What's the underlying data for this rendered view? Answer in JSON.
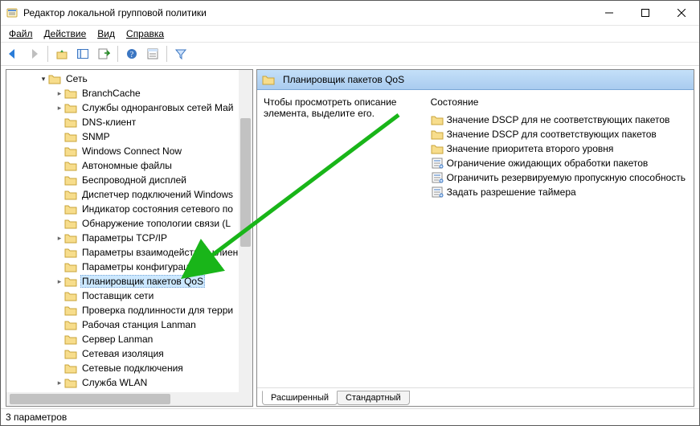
{
  "window": {
    "title": "Редактор локальной групповой политики"
  },
  "menus": {
    "file": "Файл",
    "action": "Действие",
    "view": "Вид",
    "help": "Справка"
  },
  "tree_parent": {
    "label": "Сеть"
  },
  "tree_items": [
    {
      "label": "BranchCache",
      "expander": ">"
    },
    {
      "label": "Службы одноранговых сетей Май",
      "expander": ">"
    },
    {
      "label": "DNS-клиент",
      "expander": ""
    },
    {
      "label": "SNMP",
      "expander": ""
    },
    {
      "label": "Windows Connect Now",
      "expander": ""
    },
    {
      "label": "Автономные файлы",
      "expander": ""
    },
    {
      "label": "Беспроводной дисплей",
      "expander": ""
    },
    {
      "label": "Диспетчер подключений Windows",
      "expander": ""
    },
    {
      "label": "Индикатор состояния сетевого по",
      "expander": ""
    },
    {
      "label": "Обнаружение топологии связи (L",
      "expander": ""
    },
    {
      "label": "Параметры TCP/IP",
      "expander": ">"
    },
    {
      "label": "Параметры взаимодействия клиен",
      "expander": ""
    },
    {
      "label": "Параметры конфигурации SSL",
      "expander": ""
    },
    {
      "label": "Планировщик пакетов QoS",
      "expander": ">",
      "selected": true
    },
    {
      "label": "Поставщик сети",
      "expander": ""
    },
    {
      "label": "Проверка подлинности для терри",
      "expander": ""
    },
    {
      "label": "Рабочая станция Lanman",
      "expander": ""
    },
    {
      "label": "Сервер Lanman",
      "expander": ""
    },
    {
      "label": "Сетевая изоляция",
      "expander": ""
    },
    {
      "label": "Сетевые подключения",
      "expander": ""
    },
    {
      "label": "Служба WLAN",
      "expander": ">"
    }
  ],
  "right": {
    "header_title": "Планировщик пакетов QoS",
    "description": "Чтобы просмотреть описание элемента, выделите его.",
    "state_heading": "Состояние",
    "items": [
      {
        "kind": "folder",
        "label": "Значение DSCP для не соответствующих пакетов"
      },
      {
        "kind": "folder",
        "label": "Значение DSCP для соответствующих пакетов"
      },
      {
        "kind": "folder",
        "label": "Значение приоритета второго уровня"
      },
      {
        "kind": "setting",
        "label": "Ограничение ожидающих обработки пакетов"
      },
      {
        "kind": "setting",
        "label": "Ограничить резервируемую пропускную способность"
      },
      {
        "kind": "setting",
        "label": "Задать разрешение таймера"
      }
    ],
    "tabs": {
      "extended": "Расширенный",
      "standard": "Стандартный"
    }
  },
  "status": "3 параметров"
}
